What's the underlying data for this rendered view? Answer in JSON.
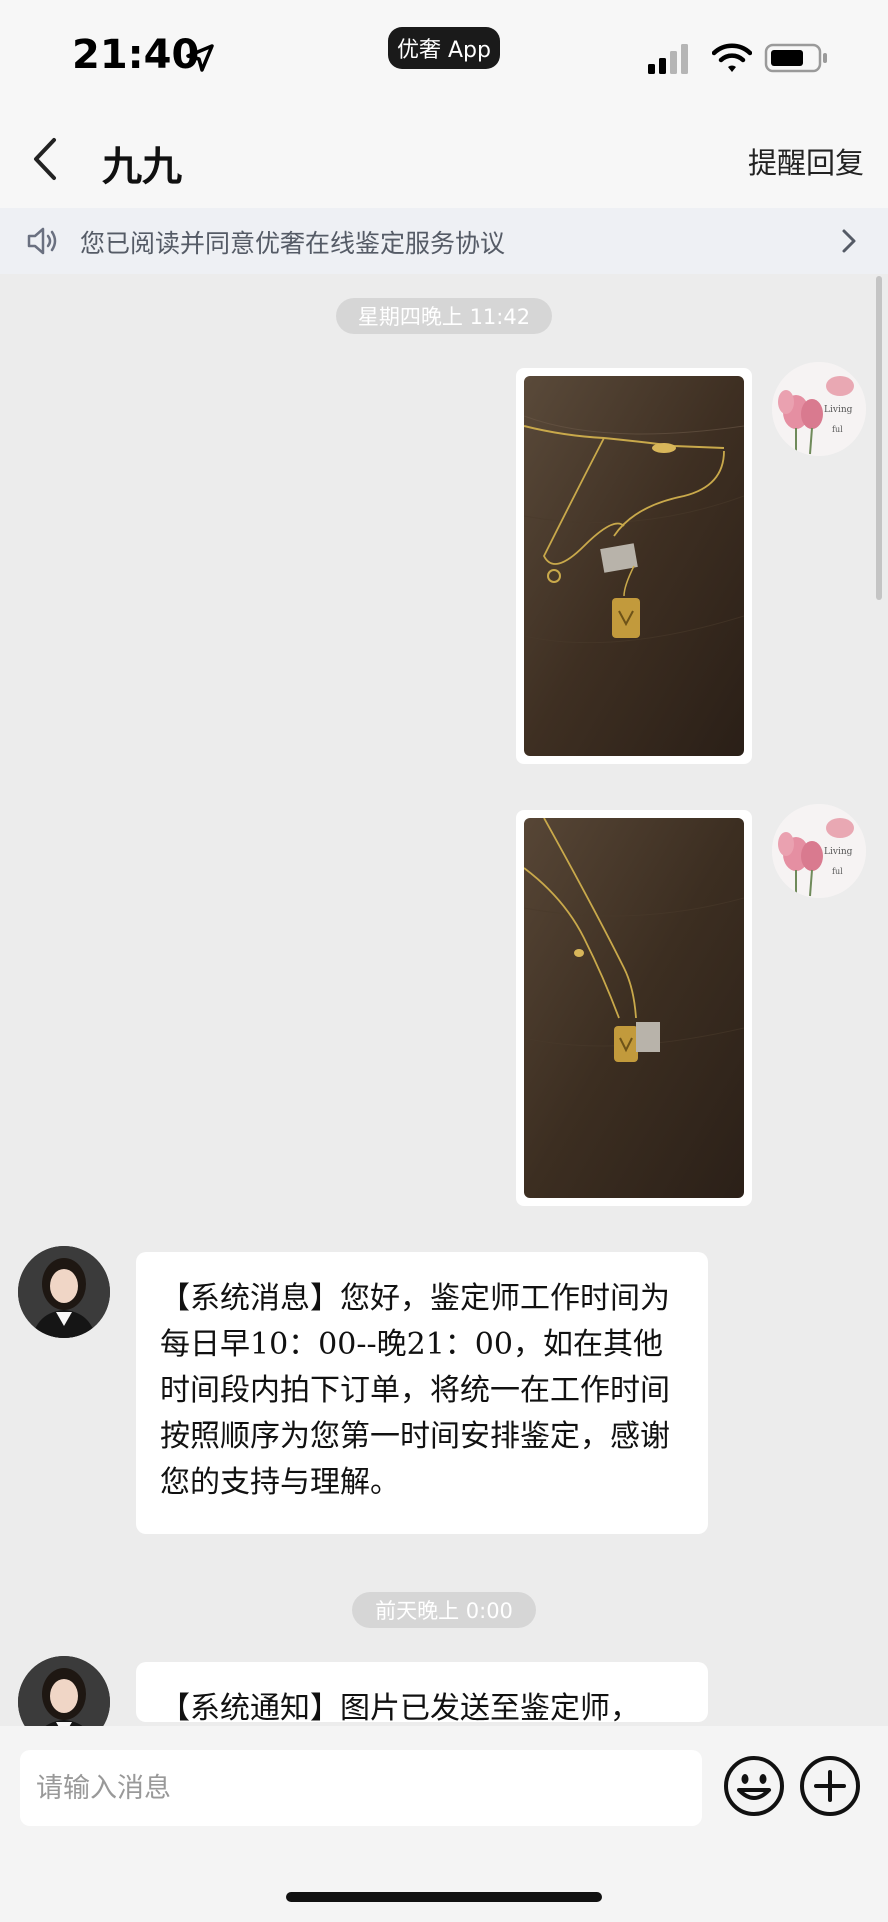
{
  "status_bar": {
    "time": "21:40",
    "app_badge": "优奢 App"
  },
  "header": {
    "title": "九九",
    "action": "提醒回复"
  },
  "notice": {
    "text": "您已阅读并同意优奢在线鉴定服务协议"
  },
  "messages": {
    "timestamp_1": "星期四晚上 11:42",
    "system_message": "【系统消息】您好，鉴定师工作时间为每日早10：00--晚21：00，如在其他时间段内拍下订单，将统一在工作时间按照顺序为您第一时间安排鉴定，感谢您的支持与理解。",
    "timestamp_2": "前天晚上 0:00",
    "system_notice": "【系统通知】图片已发送至鉴定师，"
  },
  "composer": {
    "placeholder": "请输入消息"
  },
  "colors": {
    "chat_bg": "#ececec",
    "bubble": "#ffffff",
    "timestamp_pill": "#d6d6d6"
  },
  "icons": [
    "location-arrow-icon",
    "cellular-signal-icon",
    "wifi-icon",
    "battery-icon",
    "back-chevron-icon",
    "speaker-icon",
    "chevron-right-icon",
    "emoji-icon",
    "plus-icon"
  ]
}
